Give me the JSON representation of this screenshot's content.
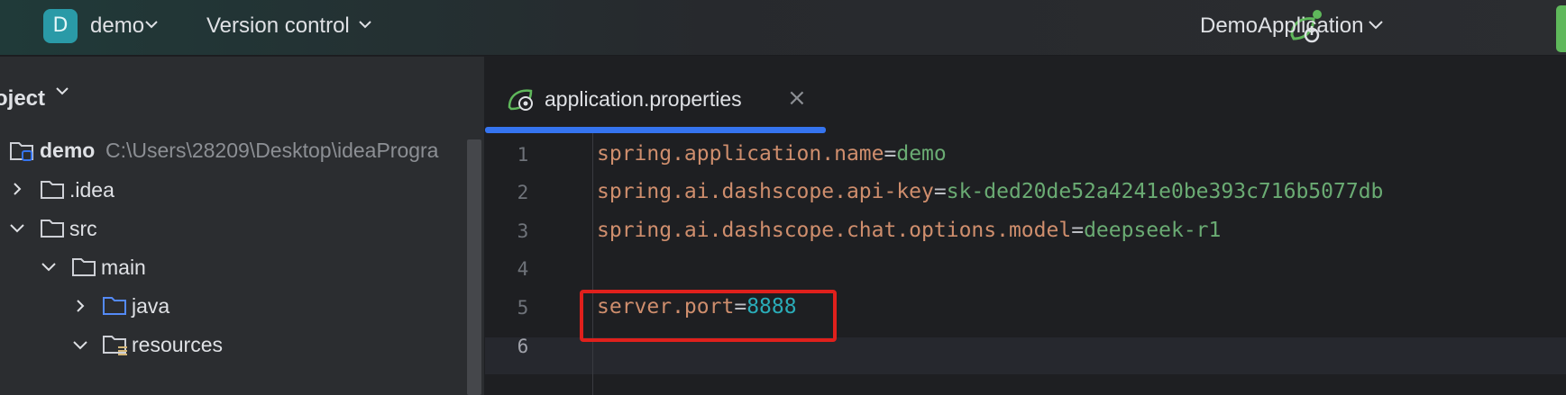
{
  "topbar": {
    "project_initial": "D",
    "project_name": "demo",
    "vcs_label": "Version control",
    "run_config": "DemoApplication"
  },
  "sidebar": {
    "title": "oject",
    "tree": [
      {
        "label": "demo",
        "path": "C:\\Users\\28209\\Desktop\\ideaProgra",
        "expanded": true,
        "icon": "module-folder-icon"
      },
      {
        "label": ".idea",
        "expanded": false,
        "icon": "folder-icon"
      },
      {
        "label": "src",
        "expanded": true,
        "icon": "folder-icon"
      },
      {
        "label": "main",
        "expanded": true,
        "icon": "folder-icon"
      },
      {
        "label": "java",
        "expanded": false,
        "icon": "source-folder-icon"
      },
      {
        "label": "resources",
        "expanded": true,
        "icon": "resources-folder-icon"
      }
    ]
  },
  "editor": {
    "tab_label": "application.properties",
    "lines": [
      {
        "no": "1",
        "key": "spring.application.name",
        "eq": "=",
        "value": "demo"
      },
      {
        "no": "2",
        "key": "spring.ai.dashscope.api-key",
        "eq": "=",
        "value": "sk-ded20de52a4241e0be393c716b5077db"
      },
      {
        "no": "3",
        "key": "spring.ai.dashscope.chat.options.model",
        "eq": "=",
        "value": "deepseek-r1"
      },
      {
        "no": "4",
        "key": "",
        "eq": "",
        "value": ""
      },
      {
        "no": "5",
        "key": "server.port",
        "eq": "=",
        "value": "8888"
      },
      {
        "no": "6",
        "key": "",
        "eq": "",
        "value": ""
      }
    ]
  },
  "colors": {
    "accent": "#3574f0",
    "highlight_box": "#e0201c",
    "project_badge": "#2a9aa7",
    "key": "#cf8e6d",
    "string_value": "#6aab73",
    "number_value": "#2aacb8"
  }
}
